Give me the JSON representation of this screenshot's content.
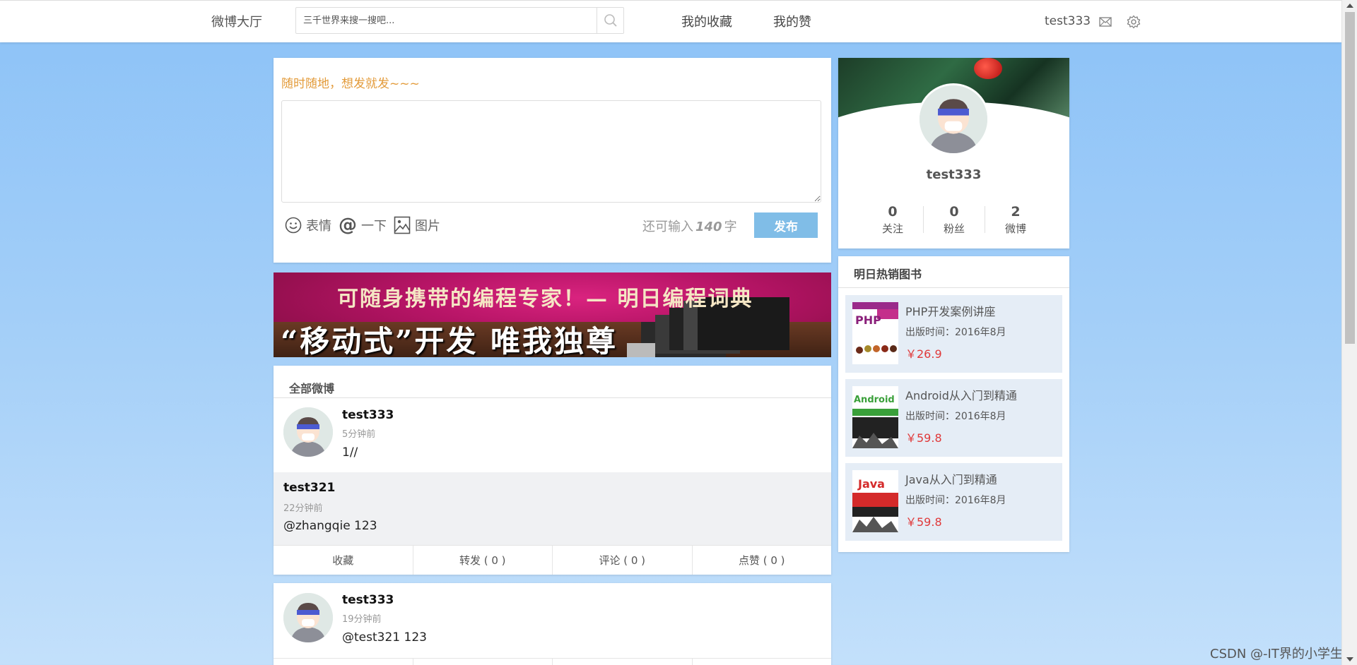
{
  "nav": {
    "brand": "微博大厅",
    "search_placeholder": "三千世界来搜一搜吧...",
    "favorites": "我的收藏",
    "likes": "我的赞",
    "username": "test333"
  },
  "post_box": {
    "prompt": "随时随地，想发就发~~~",
    "emoji_label": "表情",
    "mention_label": "一下",
    "mention_symbol": "@",
    "image_label": "图片",
    "remain_prefix": "还可输入",
    "remain_count": "140",
    "remain_suffix": "字",
    "publish": "发布"
  },
  "banner": {
    "line1": "可随身携带的编程专家！— 明日编程词典",
    "line2": "“移动式”开发 唯我独尊"
  },
  "feed": {
    "title": "全部微博",
    "posts": [
      {
        "user": "test333",
        "time": "5分钟前",
        "content": "1//",
        "quote": {
          "user": "test321",
          "time": "22分钟前",
          "content": "@zhangqie 123"
        },
        "actions": [
          "收藏",
          "转发 ( 0 )",
          "评论 ( 0 )",
          "点赞 ( 0 )"
        ]
      },
      {
        "user": "test333",
        "time": "19分钟前",
        "content": "@test321 123"
      }
    ]
  },
  "profile": {
    "name": "test333",
    "stats": [
      {
        "num": "0",
        "label": "关注"
      },
      {
        "num": "0",
        "label": "粉丝"
      },
      {
        "num": "2",
        "label": "微博"
      }
    ]
  },
  "books": {
    "title": "明日热销图书",
    "items": [
      {
        "title": "PHP开发案例讲座",
        "date": "出版时间：2016年8月",
        "price": "￥26.9",
        "cover_text": "PHP"
      },
      {
        "title": "Android从入门到精通",
        "date": "出版时间：2016年8月",
        "price": "￥59.8",
        "cover_text": "Android"
      },
      {
        "title": "Java从入门到精通",
        "date": "出版时间：2016年8月",
        "price": "￥59.8",
        "cover_text": "Java"
      }
    ]
  },
  "watermark": "CSDN @-IT界的小学生、",
  "colors": {
    "accent": "#80bde7",
    "prompt": "#e39b3a",
    "price": "#e0393a"
  }
}
